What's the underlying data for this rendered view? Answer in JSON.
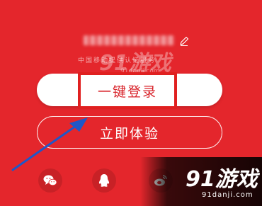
{
  "account": {
    "masked_phone": "",
    "carrier_notice": "中国移动提供认证服务"
  },
  "buttons": {
    "one_click_login": "一键登录",
    "try_now": "立即体验"
  },
  "social_login": [
    {
      "icon": "wechat-icon"
    },
    {
      "icon": "qq-icon"
    },
    {
      "icon": "weibo-icon"
    }
  ],
  "watermark": {
    "brand": "91游戏",
    "url": "91danji.com"
  },
  "colors": {
    "background": "#e4262c",
    "highlight": "#e02020",
    "button_text": "#d8232a"
  }
}
